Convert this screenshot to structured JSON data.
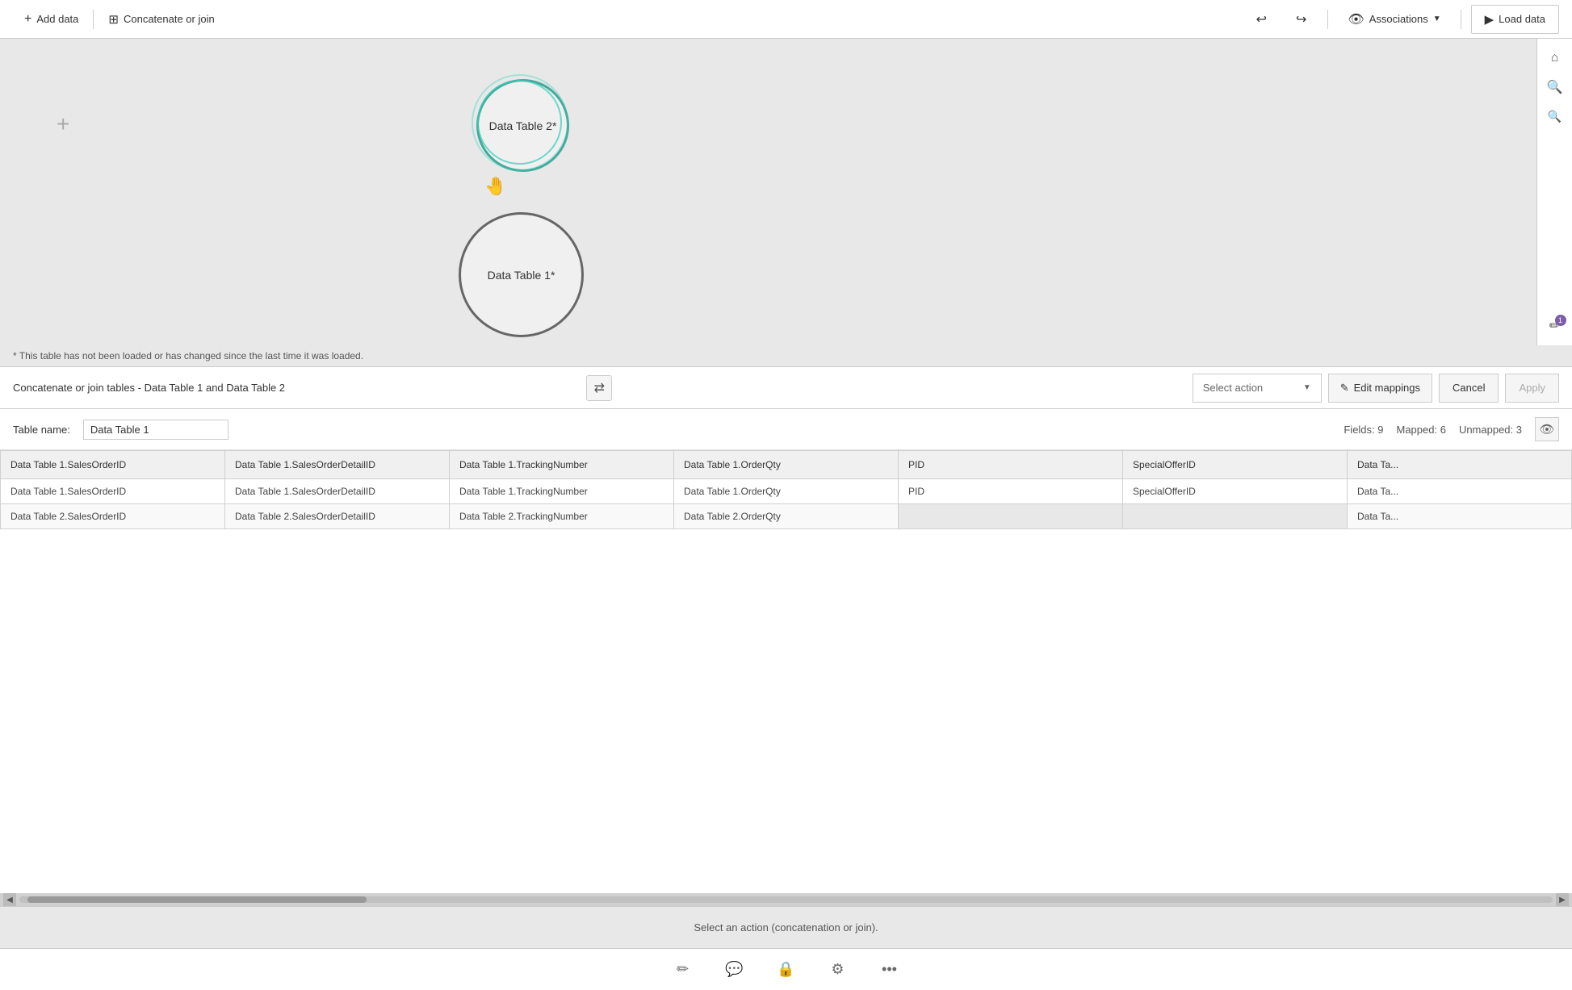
{
  "toolbar": {
    "add_data_label": "Add data",
    "concatenate_join_label": "Concatenate or join",
    "associations_label": "Associations",
    "load_data_label": "Load data"
  },
  "canvas": {
    "warning_text": "* This table has not been loaded or has changed since the last time it was loaded.",
    "table_node_2_label": "Data Table 2*",
    "table_node_1_label": "Data Table 1*"
  },
  "panel": {
    "title": "Concatenate or join tables - Data Table 1 and Data Table 2",
    "select_action_label": "Select action",
    "edit_mappings_label": "Edit mappings",
    "cancel_label": "Cancel",
    "apply_label": "Apply",
    "table_name_label": "Table name:",
    "table_name_value": "Data Table 1",
    "fields_label": "Fields: 9",
    "mapped_label": "Mapped: 6",
    "unmapped_label": "Unmapped: 3"
  },
  "table": {
    "columns": [
      "Data Table 1.SalesOrderID",
      "Data Table 1.SalesOrderDetailID",
      "Data Table 1.TrackingNumber",
      "Data Table 1.OrderQty",
      "PID",
      "SpecialOfferID",
      "Data Ta..."
    ],
    "rows": [
      [
        "Data Table 1.SalesOrderID",
        "Data Table 1.SalesOrderDetailID",
        "Data Table 1.TrackingNumber",
        "Data Table 1.OrderQty",
        "PID",
        "SpecialOfferID",
        "Data Ta..."
      ],
      [
        "Data Table 2.SalesOrderID",
        "Data Table 2.SalesOrderDetailID",
        "Data Table 2.TrackingNumber",
        "Data Table 2.OrderQty",
        "",
        "",
        "Data Ta..."
      ]
    ]
  },
  "status": {
    "message": "Select an action (concatenation or join)."
  },
  "bottom_icons": [
    "pencil",
    "chat",
    "lock",
    "settings",
    "more"
  ]
}
